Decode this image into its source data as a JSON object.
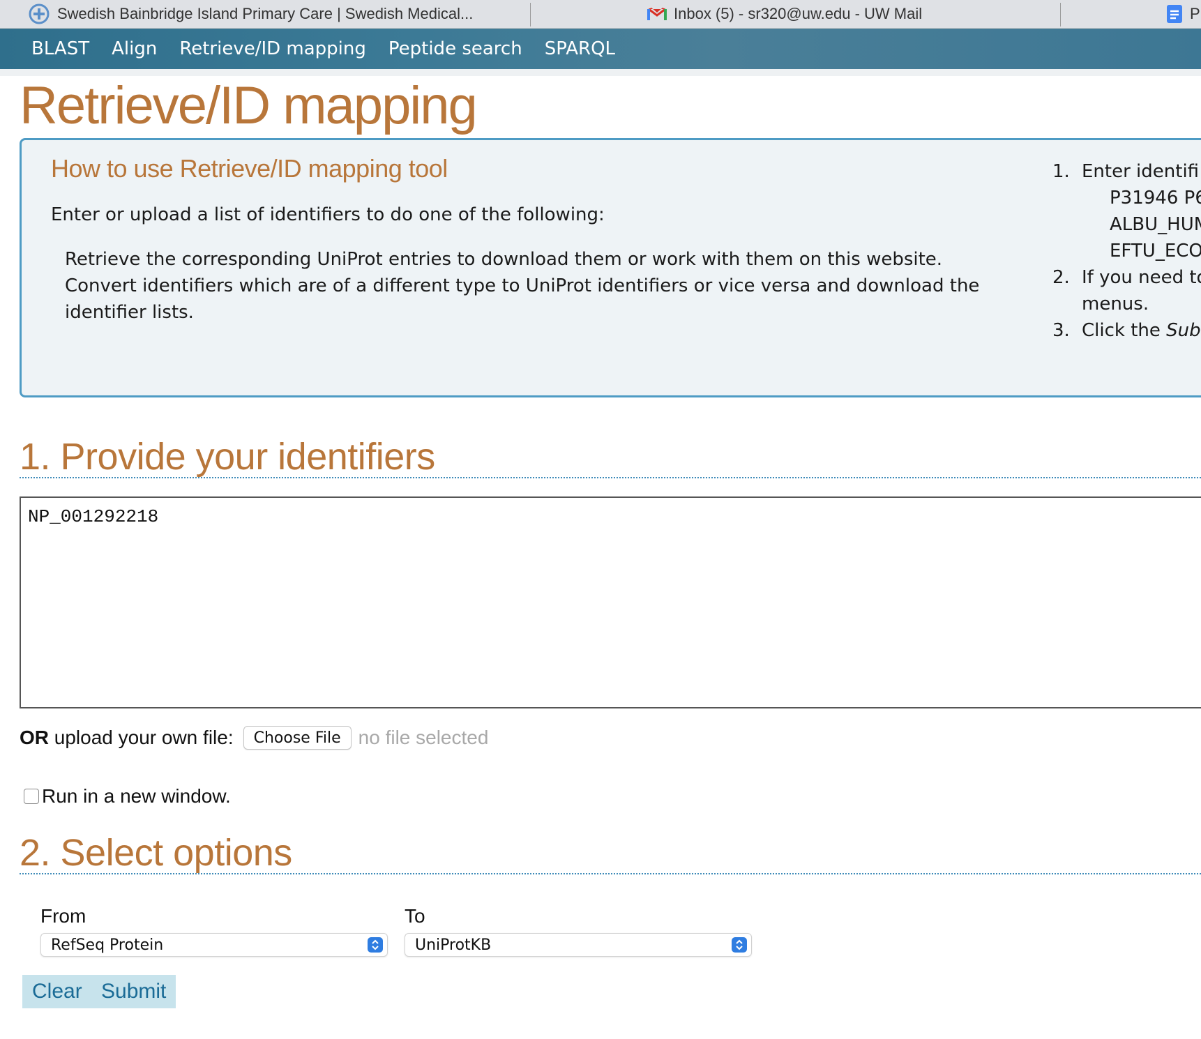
{
  "browser": {
    "tabs": [
      {
        "title": "Swedish Bainbridge Island Primary Care | Swedish Medical..."
      },
      {
        "title": "Inbox (5) - sr320@uw.edu - UW Mail"
      },
      {
        "title": "P"
      }
    ]
  },
  "nav": {
    "items": [
      "BLAST",
      "Align",
      "Retrieve/ID mapping",
      "Peptide search",
      "SPARQL"
    ]
  },
  "page": {
    "title": "Retrieve/ID mapping"
  },
  "help": {
    "title": "How to use Retrieve/ID mapping tool",
    "intro": "Enter or upload a list of identifiers to do one of the following:",
    "lines": [
      "Retrieve the corresponding UniProt entries to download them or work with them on this website.",
      "Convert identifiers which are of a different type to UniProt identifiers or vice versa and download the",
      "identifier lists."
    ],
    "steps": [
      {
        "num": "1.",
        "text": "Enter identifi"
      },
      {
        "num": "",
        "text": "P31946 P6"
      },
      {
        "num": "",
        "text": "ALBU_HUM"
      },
      {
        "num": "",
        "text": "EFTU_ECO"
      },
      {
        "num": "2.",
        "text": "If you need to"
      },
      {
        "num": "",
        "text": "menus."
      },
      {
        "num": "3.",
        "text": "Click the ",
        "italic": "Sub"
      }
    ]
  },
  "section1": {
    "heading": "1. Provide your identifiers",
    "identifiers_value": "NP_001292218",
    "upload_or": "OR",
    "upload_label": " upload your own file:",
    "choose_file_label": "Choose File",
    "no_file_text": "no file selected",
    "run_new_window_label": "Run in a new window.",
    "run_new_window_checked": false
  },
  "section2": {
    "heading": "2. Select options",
    "from_label": "From",
    "from_value": "RefSeq Protein",
    "to_label": "To",
    "to_value": "UniProtKB"
  },
  "buttons": {
    "clear": "Clear",
    "submit": "Submit"
  },
  "colors": {
    "nav_background": "#3c7a96",
    "heading_orange": "#b8763a",
    "help_border": "#4e9bc4",
    "button_bg": "#c7e3ec",
    "button_text": "#1a6b96",
    "select_arrow_blue": "#2f7de1"
  },
  "icons": {
    "tab1": "swedish-logo-icon",
    "tab2": "gmail-icon",
    "tab3": "docs-icon"
  }
}
